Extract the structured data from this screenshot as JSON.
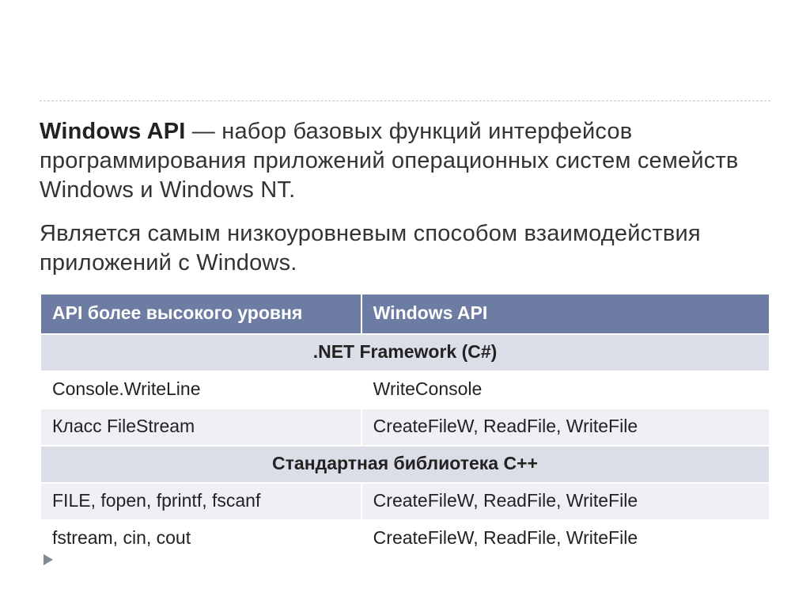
{
  "para1": {
    "term": "Windows API",
    "rest": "  — набор базовых функций интерфейсов программирования приложений операционных систем семейств Windows и Windows NT."
  },
  "para2": "Является самым низкоуровневым способом взаимодействия приложений с Windows.",
  "table": {
    "headers": {
      "col1": "API более высокого уровня",
      "col2": "Windows API"
    },
    "section1": ".NET Framework (C#)",
    "row1": {
      "c1": "Console.WriteLine",
      "c2": "WriteConsole"
    },
    "row2": {
      "c1": "Класс FileStream",
      "c2": "CreateFileW, ReadFile, WriteFile"
    },
    "section2": "Стандартная библиотека С++",
    "row3": {
      "c1": "FILE, fopen, fprintf, fscanf",
      "c2": "CreateFileW, ReadFile, WriteFile"
    },
    "row4": {
      "c1": "fstream, cin, cout",
      "c2": "CreateFileW, ReadFile, WriteFile"
    }
  }
}
